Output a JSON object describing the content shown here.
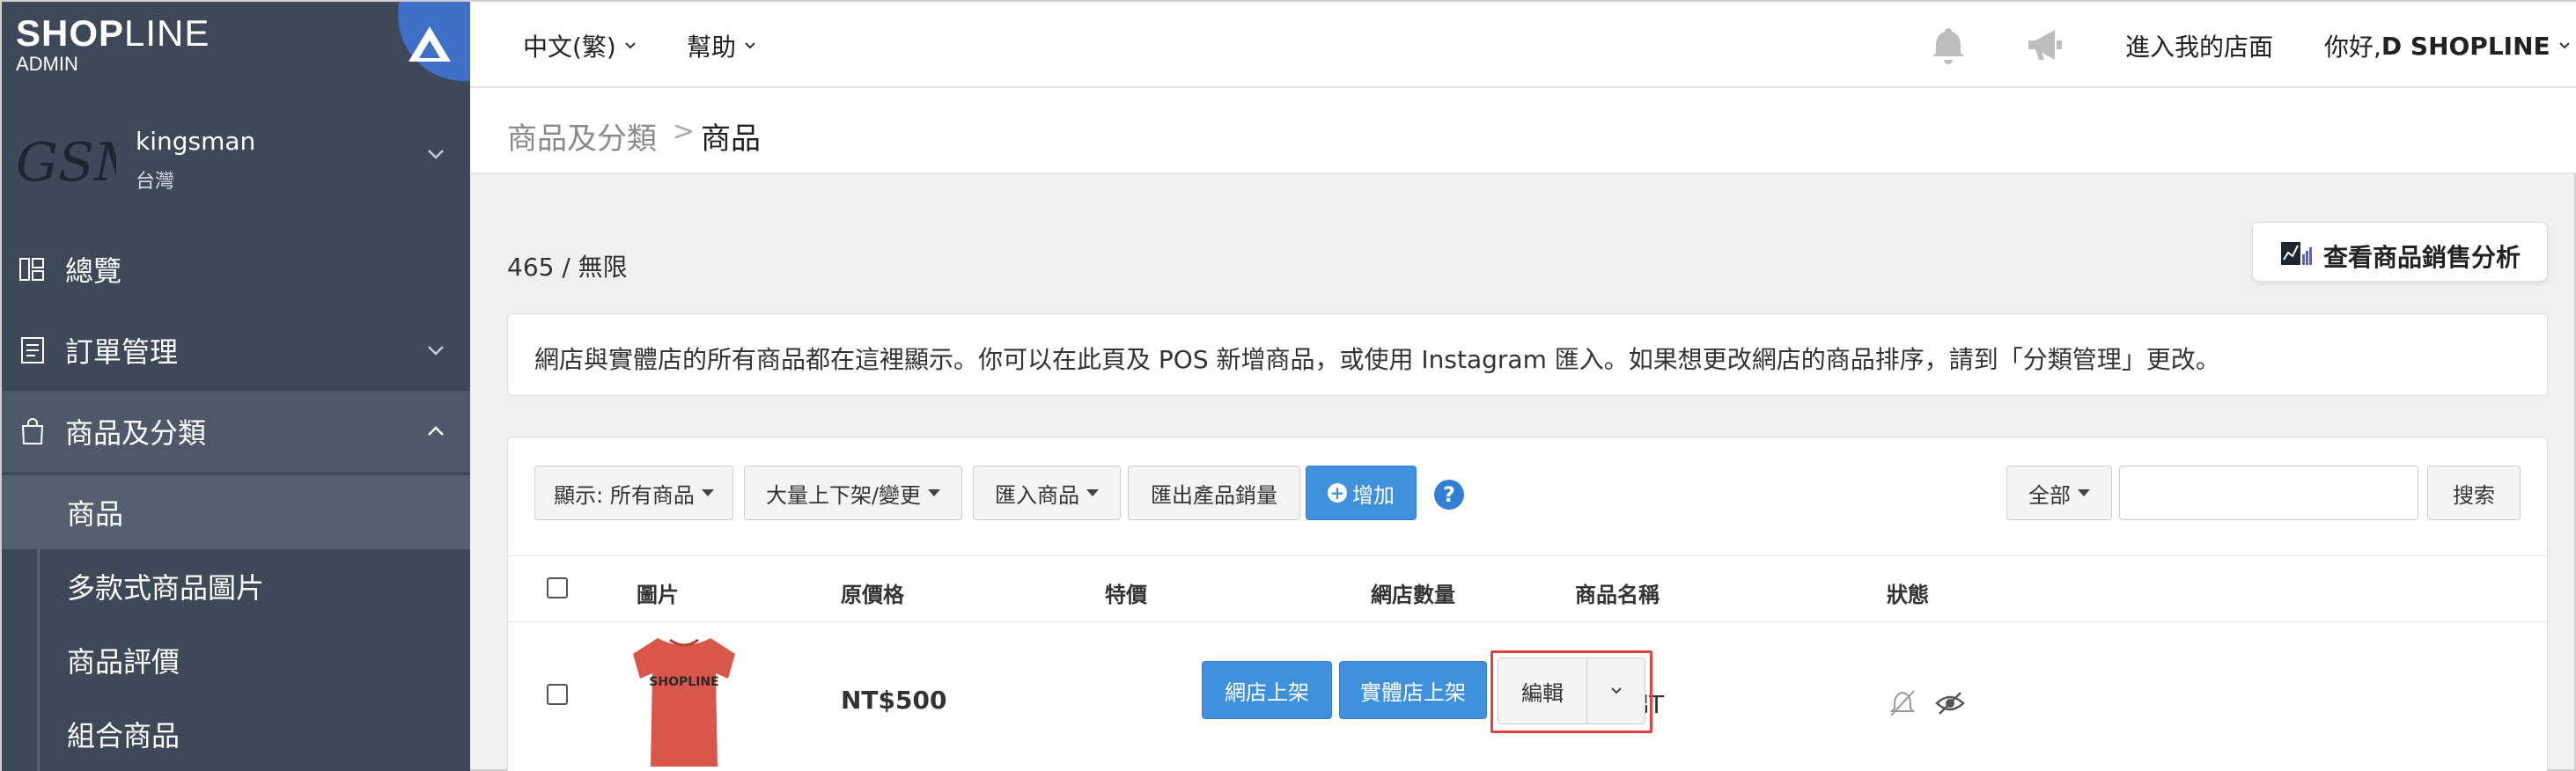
{
  "sidebar": {
    "brand": "SHOPLINE",
    "brand_bold": "SHOP",
    "brand_thin": "LINE",
    "admin": "ADMIN",
    "store": {
      "logo_text": "GSM",
      "name": "kingsman",
      "region": "台灣"
    },
    "menu": [
      {
        "label": "總覽",
        "icon": "dashboard-icon"
      },
      {
        "label": "訂單管理",
        "icon": "orders-icon"
      },
      {
        "label": "商品及分類",
        "icon": "shopping-bag-icon"
      }
    ],
    "submenu": [
      {
        "label": "商品",
        "active": true
      },
      {
        "label": "多款式商品圖片"
      },
      {
        "label": "商品評價"
      },
      {
        "label": "組合商品"
      }
    ]
  },
  "topbar": {
    "language": "中文(繁)",
    "help": "幫助",
    "enter_store": "進入我的店面",
    "greeting_prefix": "你好, ",
    "greeting_name": "D SHOPLINE"
  },
  "breadcrumb": {
    "parent": "商品及分類",
    "separator": ">",
    "current": "商品"
  },
  "main": {
    "count": "465 / 無限",
    "analysis_button": "查看商品銷售分析",
    "info": "網店與實體店的所有商品都在這裡顯示。你可以在此頁及 POS 新增商品，或使用 Instagram 匯入。如果想更改網店的商品排序，請到「分類管理」更改。"
  },
  "toolbar": {
    "filter": "顯示: 所有商品",
    "bulk": "大量上下架/變更",
    "import": "匯入商品",
    "export": "匯出產品銷量",
    "add": "增加",
    "help": "?",
    "scope": "全部",
    "search_placeholder": "",
    "search": "搜索"
  },
  "table": {
    "columns": [
      "圖片",
      "原價格",
      "特價",
      "網店數量",
      "商品名稱",
      "狀態"
    ],
    "rows": [
      {
        "image": "red-tshirt",
        "shirt_print": "SHOPLINE",
        "price": "NT$500",
        "sale_price": "",
        "quantity": "∞",
        "name": "紅色棉T",
        "online_button": "網店上架",
        "retail_button": "實體店上架",
        "edit_button": "編輯"
      }
    ]
  },
  "colors": {
    "sidebar": "#3d4858",
    "primary": "#3f90dd",
    "highlight": "#e0443c"
  }
}
